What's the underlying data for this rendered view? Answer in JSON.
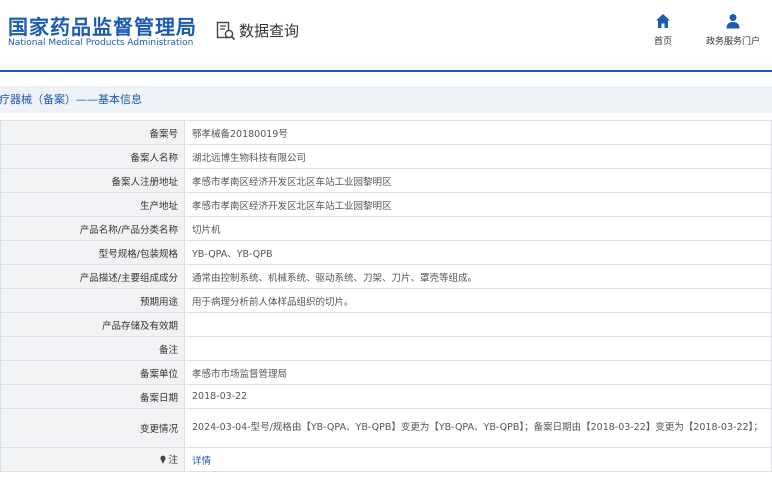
{
  "header": {
    "logo_cn": "国家药品监督管理局",
    "logo_en": "National Medical Products Administration",
    "query_title": "数据查询",
    "query_icon": "search-document-icon",
    "nav": {
      "home_label": "首页",
      "home_icon": "home-icon",
      "gov_label": "政务服务门户",
      "gov_icon": "user-icon"
    }
  },
  "section": {
    "title": "医疗器械（备案）——基本信息"
  },
  "rows": [
    {
      "label": "备案号",
      "value": "鄂孝械备20180019号"
    },
    {
      "label": "备案人名称",
      "value": "湖北远博生物科技有限公司"
    },
    {
      "label": "备案人注册地址",
      "value": "孝感市孝南区经济开发区北区车站工业园黎明区"
    },
    {
      "label": "生产地址",
      "value": "孝感市孝南区经济开发区北区车站工业园黎明区"
    },
    {
      "label": "产品名称/产品分类名称",
      "value": "切片机"
    },
    {
      "label": "型号规格/包装规格",
      "value": "YB-QPA、YB-QPB"
    },
    {
      "label": "产品描述/主要组成成分",
      "value": "通常由控制系统、机械系统、驱动系统、刀架、刀片、罩壳等组成。"
    },
    {
      "label": "预期用途",
      "value": "用于病理分析前人体样品组织的切片。"
    },
    {
      "label": "产品存储及有效期",
      "value": ""
    },
    {
      "label": "备注",
      "value": ""
    },
    {
      "label": "备案单位",
      "value": "孝感市市场监督管理局"
    },
    {
      "label": "备案日期",
      "value": "2018-03-22"
    },
    {
      "label": "变更情况",
      "value": "2024-03-04-型号/规格由【YB-QPA、YB-QPB】变更为【YB-QPA、YB-QPB】；备案日期由【2018-03-22】变更为【2018-03-22】；"
    },
    {
      "label": "注",
      "value": "详情"
    }
  ],
  "colors": {
    "brand": "#1c5bb0",
    "label_bg": "#f1f2f4",
    "border": "#dcdfe3"
  }
}
